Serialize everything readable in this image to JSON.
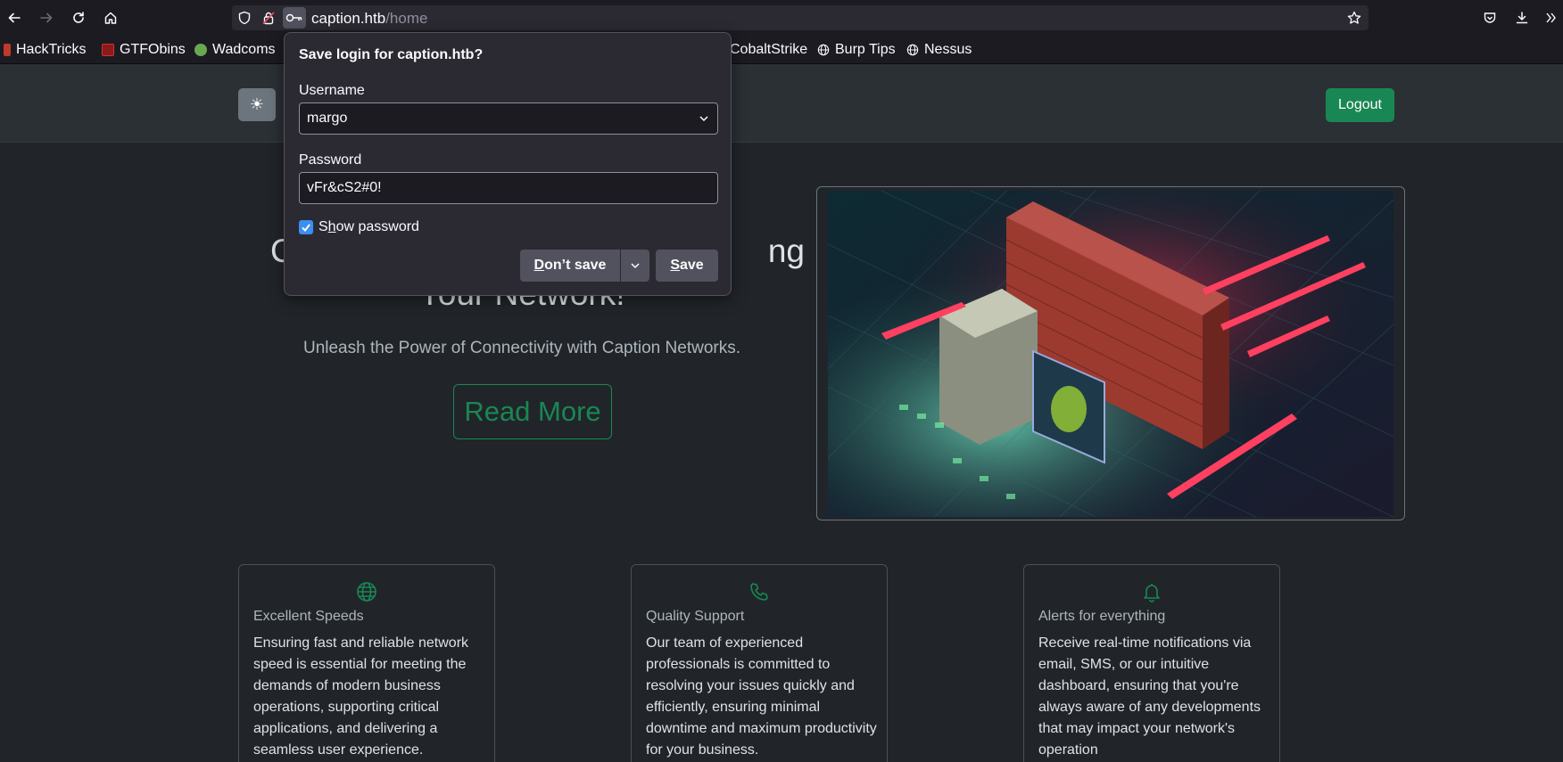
{
  "browser": {
    "url_host": "caption.htb",
    "url_path": "/home",
    "bookmarks": [
      {
        "label": "HackTricks",
        "color": "#c0392b"
      },
      {
        "label": "GTFObins",
        "color": "#8b1a1a"
      },
      {
        "label": "Wadcoms",
        "color": "#6aa84f"
      },
      {
        "label": "CobaltStrike",
        "color": "#1c1b22"
      },
      {
        "label": "Burp Tips",
        "color": "globe"
      },
      {
        "label": "Nessus",
        "color": "globe"
      }
    ]
  },
  "site": {
    "theme_toggle": "☀",
    "logout_label": "Logout",
    "hero_title_line1": "C",
    "hero_title_line1_end": "ng",
    "hero_title_line2": "Your Network!",
    "hero_subtitle": "Unleash the Power of Connectivity with Caption Networks.",
    "read_more_label": "Read More",
    "cards": [
      {
        "icon": "globe-icon",
        "title": "Excellent Speeds",
        "text": "Ensuring fast and reliable network speed is essential for meeting the demands of modern business operations, supporting critical applications, and delivering a seamless user experience."
      },
      {
        "icon": "phone-icon",
        "title": "Quality Support",
        "text": "Our team of experienced professionals is committed to resolving your issues quickly and efficiently, ensuring minimal downtime and maximum productivity for your business."
      },
      {
        "icon": "bell-icon",
        "title": "Alerts for everything",
        "text": "Receive real-time notifications via email, SMS, or our intuitive dashboard, ensuring that you're always aware of any developments that may impact your network's operation"
      }
    ]
  },
  "popup": {
    "title": "Save login for caption.htb?",
    "username_label": "Username",
    "username_value": "margo",
    "password_label": "Password",
    "password_value": "vFr&cS2#0!",
    "show_password_pre": "S",
    "show_password_u": "h",
    "show_password_post": "ow password",
    "show_password_checked": true,
    "dont_save_u": "D",
    "dont_save_rest": "on’t save",
    "save_u": "S",
    "save_rest": "ave"
  },
  "colors": {
    "accent_green": "#198754",
    "page_bg": "#212529",
    "popup_bg": "#2b2a33"
  }
}
